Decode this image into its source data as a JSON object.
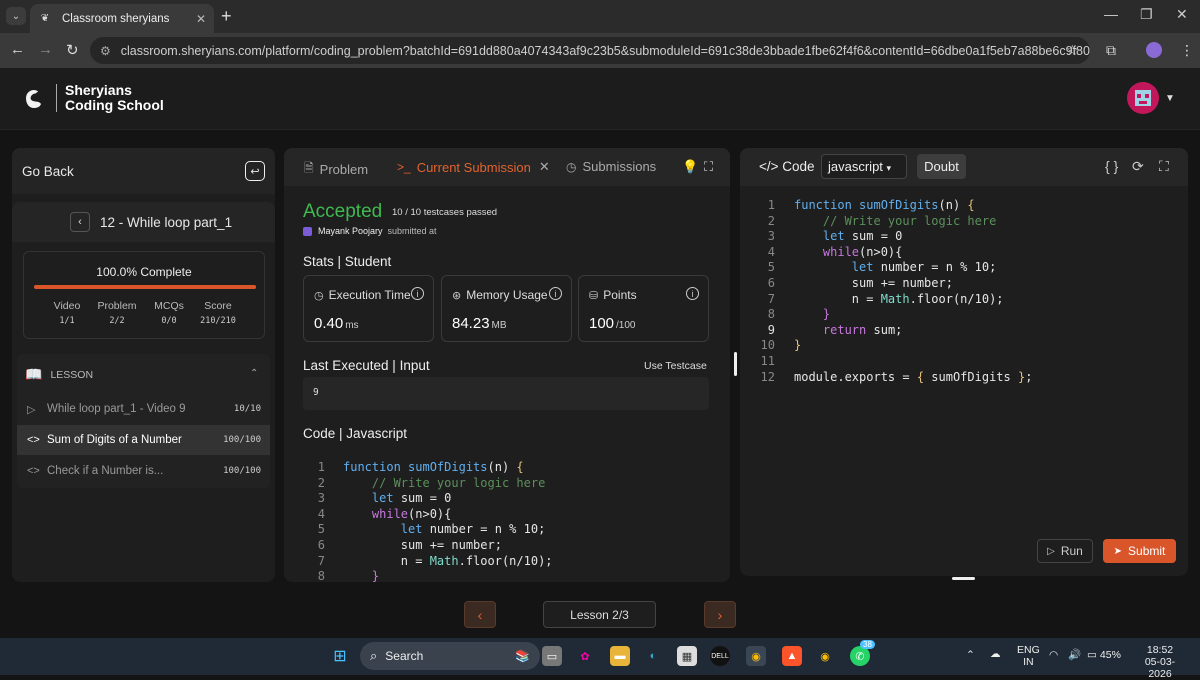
{
  "browser": {
    "tab_title": "Classroom sheryians",
    "url": "classroom.sheryians.com/platform/coding_problem?batchId=691dd880a4074343af9c23b5&submoduleId=691c38de3bbade1fbe62f4f6&contentId=66dbe0a1f5eb7a88be6c9f80&submissionId..."
  },
  "site": {
    "brand_line1": "Sheryians",
    "brand_line2": "Coding School"
  },
  "left": {
    "go_back": "Go Back",
    "lesson_title": "12 - While loop part_1",
    "progress_text": "100.0% Complete",
    "progress_value": 1.0,
    "stats": [
      {
        "label": "Video",
        "value": "1/1"
      },
      {
        "label": "Problem",
        "value": "2/2"
      },
      {
        "label": "MCQs",
        "value": "0/0"
      },
      {
        "label": "Score",
        "value": "210/210"
      }
    ],
    "lesson_label": "LESSON",
    "items": [
      {
        "label": "While loop part_1 - Video 9",
        "score": "10/10"
      },
      {
        "label": "Sum of Digits of a Number",
        "score": "100/100"
      },
      {
        "label": "Check if a Number is...",
        "score": "100/100"
      }
    ]
  },
  "middle": {
    "tabs": [
      "Problem",
      "Current Submission",
      "Submissions"
    ],
    "status": "Accepted",
    "testcases": "10 / 10 testcases passed",
    "submitter": "Mayank Poojary",
    "submitted_at": "submitted at",
    "stats_heading": "Stats | Student",
    "cards": [
      {
        "title": "Execution Time",
        "value": "0.40",
        "unit": "ms"
      },
      {
        "title": "Memory Usage",
        "value": "84.23",
        "unit": "MB"
      },
      {
        "title": "Points",
        "value": "100",
        "unit": "/100"
      }
    ],
    "last_executed": "Last Executed | Input",
    "use_testcase": "Use Testcase",
    "input_value": "9",
    "code_heading": "Code | Javascript"
  },
  "right": {
    "code_label": "Code",
    "language": "javascript",
    "doubt": "Doubt",
    "run": "Run",
    "submit": "Submit"
  },
  "footer": {
    "lesson_indicator": "Lesson 2/3"
  },
  "taskbar": {
    "search": "Search",
    "lang_top": "ENG",
    "lang_bottom": "IN",
    "battery": "45%",
    "time": "18:52",
    "date": "05-03-2026",
    "whatsapp_badge": "38"
  },
  "colors": {
    "accent": "#d9562b",
    "accepted": "#3fb950"
  }
}
